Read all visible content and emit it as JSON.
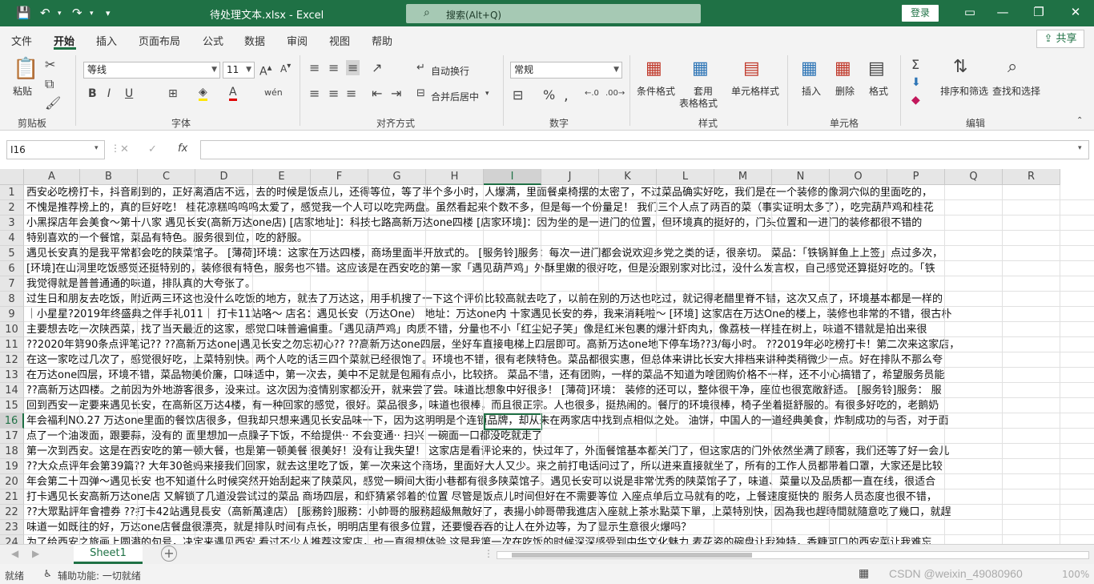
{
  "titlebar": {
    "title": "待处理文本.xlsx  -  Excel",
    "search_placeholder": "搜索(Alt+Q)",
    "login": "登录"
  },
  "menu": [
    "文件",
    "开始",
    "插入",
    "页面布局",
    "公式",
    "数据",
    "审阅",
    "视图",
    "帮助"
  ],
  "share": "共享",
  "ribbon": {
    "clipboard": {
      "paste": "粘贴",
      "group": "剪贴板"
    },
    "font": {
      "name": "等线",
      "size": "11",
      "group": "字体"
    },
    "alignment": {
      "wrap": "自动换行",
      "merge": "合并后居中",
      "group": "对齐方式"
    },
    "number": {
      "format": "常规",
      "group": "数字"
    },
    "styles": {
      "cond": "条件格式",
      "table": "套用",
      "table2": "表格格式",
      "cell": "单元格样式",
      "group": "样式"
    },
    "cells": {
      "insert": "插入",
      "delete": "删除",
      "format": "格式",
      "group": "单元格"
    },
    "editing": {
      "sort": "排序和筛选",
      "find": "查找和选择",
      "group": "编辑"
    }
  },
  "formula": {
    "namebox": "I16",
    "fx": "fx"
  },
  "columns": [
    "A",
    "B",
    "C",
    "D",
    "E",
    "F",
    "G",
    "H",
    "I",
    "J",
    "K",
    "L",
    "M",
    "N",
    "O",
    "P",
    "Q",
    "R"
  ],
  "rows": [
    {
      "n": "1",
      "text": "西安必吃榜打卡，抖音刷到的，正好离酒店不远，去的时候是饭点儿，还得等位，等了半个多小时，人爆满，里面餐桌椅摆的太密了，不过菜品确实好吃，我们是在一个装修的像洞穴似的里面吃的，"
    },
    {
      "n": "2",
      "text": "不愧是推荐榜上的，真的巨好吃！ 桂花凉糕呜呜呜太爱了，感觉我一个人可以吃完两盘。虽然看起来个数不多，但是每一个份量足！ 我们三个人点了两百的菜（事实证明太多了），吃完葫芦鸡和桂花"
    },
    {
      "n": "3",
      "text": "小黑探店年会美食～第十八家 遇见长安(高新万达one店)  [店家地址]：科技七路高新万达one四楼  [店家环境]：因为坐的是一进门的位置，但环境真的挺好的，门头位置和一进门的装修都很不错的"
    },
    {
      "n": "4",
      "text": "特别喜欢的一个餐馆，菜品有特色。服务很到位，吃的舒服。"
    },
    {
      "n": "5",
      "text": "遇见长安真的是我平常都会吃的陕菜馆子。 [薄荷]环境：这家在万达四楼，商场里面半开放式的。 [服务铃]服务：每次一进门都会说欢迎乡党之类的话，很亲切。 菜品：「铁锅鲜鱼上上签」点过多次，"
    },
    {
      "n": "6",
      "text": "[环境]在山洞里吃饭感觉还挺特别的，装修很有特色，服务也不错。这应该是在西安吃的第一家「遇见葫芦鸡」外酥里嫩的很好吃，但是没跟别家对比过，没什么发言权，自己感觉还算挺好吃的。「铁"
    },
    {
      "n": "7",
      "text": "我觉得就是普普通通的味道，排队真的大夸张了。"
    },
    {
      "n": "8",
      "text": "过生日和朋友去吃饭，附近两三环这也没什么吃饭的地方，就去了万达这，用手机搜了一下这个评价比较高就去吃了，以前在别的万达也吃过，就记得老醋里脊不错，这次又点了，环境基本都是一样的"
    },
    {
      "n": "9",
      "text": "｜小星星?2019年终盛典之伴手礼011｜ 打卡11站咯～ 店名：遇见长安（万达One） 地址：万达one内 十家遇见长安的券，我来消耗啦～ [环境] 这家店在万达One的楼上，装修也非常的不错，很古朴"
    },
    {
      "n": "10",
      "text": "主要想去吃一次陕西菜，找了当天最近的这家，感觉口味普遍偏重。「遇见葫芦鸡」肉质不错，分量也不小「红尘妃子笑」像是红米包裹的爆汁虾肉丸，像荔枝一样挂在树上，味道不错就是拍出来很"
    },
    {
      "n": "11",
      "text": "??2020年第90条点评笔记?? ??高新万达one|遇见长安之勿忘初心?? ??高新万达one四层，坐好车直接电梯上四层即可。高新万达one地下停车场??3/每小时。 ??2019年必吃榜打卡！第二次来这家店，"
    },
    {
      "n": "12",
      "text": "在这一家吃过几次了，感觉很好吃，上菜特别快。两个人吃的话三四个菜就已经很饱了。环境也不错，很有老陕特色。菜品都很实惠，但总体来讲比长安大排档来讲种类稍微少一点。好在排队不那么夸"
    },
    {
      "n": "13",
      "text": "在万达one四层，环境不错，菜品物美价廉，口味适中，第一次去，美中不足就是包厢有点小，比较挤。 菜品不错，还有团购，一样的菜品不知道为啥团购价格不一样，还不小心搞错了，希望服务员能"
    },
    {
      "n": "14",
      "text": "??高新万达四楼。之前因为外地游客很多，没来过。这次因为疫情别家都没开，就来尝了尝。味道比想象中好很多！ [薄荷]环境： 装修的还可以，整体很干净，座位也很宽敞舒适。 [服务铃]服务： 服"
    },
    {
      "n": "15",
      "text": "回到西安一定要来遇见长安，在高新区万达4楼，有一种回家的感觉，很好。菜品很多，味道也很棒，而且很正宗。人也很多，挺热闹的。餐厅的环境很棒，椅子坐着挺舒服的。有很多好吃的，老鹅奶"
    },
    {
      "n": "16",
      "text": "年会福利NO.27 万达one里面的餐饮店很多，但我却只想来遇见长安品味一下，因为这明明是个连锁品牌，却从未在两家店中找到点相似之处。 油饼，中国人的一道经典美食，炸制成功的与否，对于面"
    },
    {
      "n": "17",
      "text": "点了一个油泼面，跟要蒜，没有的 面里想加一点臊子下饭，不给提供·· 不会变通·· 扫兴 一碗面一口都没吃就走了"
    },
    {
      "n": "18",
      "text": "第一次到西安。这是在西安吃的第一顿大餐，也是第一顿美餐 很美好！没有让我失望！ 这家店是看评论来的，快过年了，外面餐馆基本都关门了，但这家店的门外依然坐满了顾客，我们还等了好一会儿"
    },
    {
      "n": "19",
      "text": "??大众点评年会第39篇?? 大年30爸妈来接我们回家，就去这里吃了饭，第一次来这个商场，里面好大人又少。来之前打电话问过了，所以进来直接就坐了，所有的工作人员都带着口罩，大家还是比较"
    },
    {
      "n": "20",
      "text": "年会第二十四弹～遇见长安 也不知道什么时候突然开始刮起来了陕菜风，感觉一瞬间大街小巷都有很多陕菜馆子。遇见长安可以说是非常优秀的陕菜馆子了，味道、菜量以及品质都一直在线，很适合"
    },
    {
      "n": "21",
      "text": "打卡遇见长安高新万达one店 又解锁了几道没尝试过的菜品 商场四层，和虾猜紧邻着的位置 尽管是饭点儿时间但好在不需要等位 入座点单后立马就有的吃，上餐速度挺快的 服务人员态度也很不错，"
    },
    {
      "n": "22",
      "text": "??大眾點評年會禮券 ??打卡42站遇見長安（高新萬達店） [服務鈴]服務：小帥哥的服務超級無敵好了，表揚小帥哥帶我進店入座就上茶水點菜下單，上菜特別快，因為我也趕時間就隨意吃了幾口，就趕"
    },
    {
      "n": "23",
      "text": "味道一如既往的好，万达one店餐盘很漂亮，就是排队时间有点长，明明店里有很多位置，还要慢吞吞的让人在外边等，为了显示生意很火爆吗？"
    },
    {
      "n": "24",
      "text": "为了给西安之旅画上圆满的句号，决定来遇见西安 看过不少人推荐这家店，也一直很想体验 这是我第一次在吃饭的时候深深感受到中华文化魅力 麦花姿的碗盘让我独特，香糖可口的西安菜让我难忘"
    }
  ],
  "sheet": {
    "tab": "Sheet1",
    "add": "+"
  },
  "status": {
    "ready": "就绪",
    "access": "辅助功能: 一切就绪",
    "zoom": "100%",
    "watermark": "CSDN @weixin_49080960"
  }
}
